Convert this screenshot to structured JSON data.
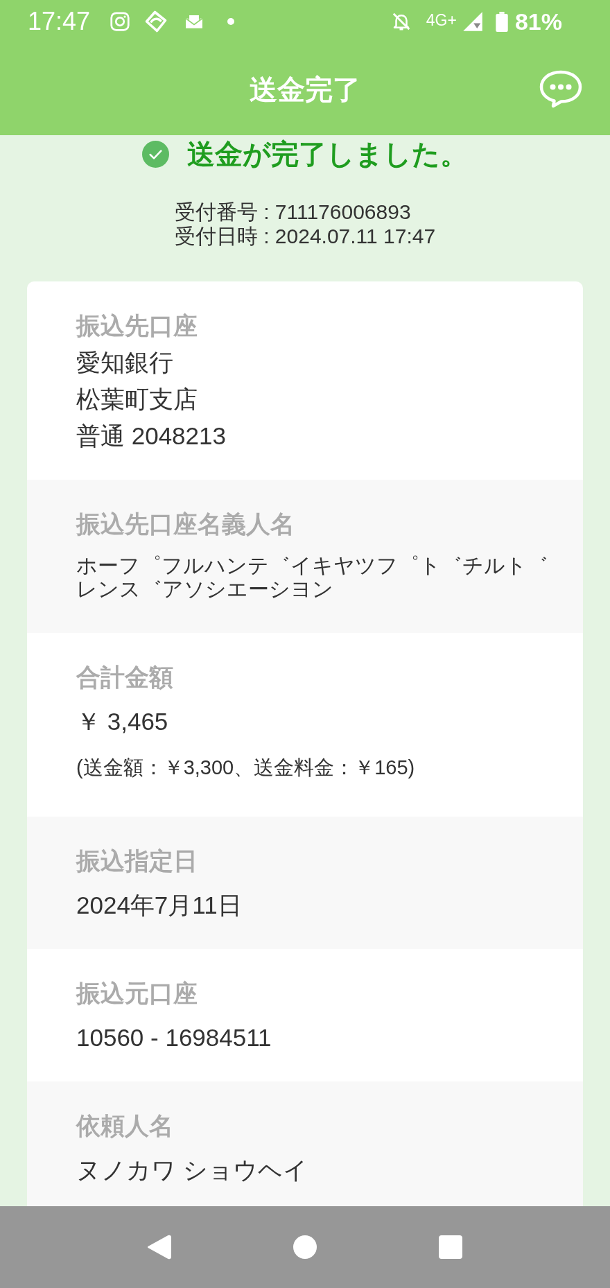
{
  "status_bar": {
    "time": "17:47",
    "network": "4G+",
    "battery": "81%"
  },
  "header": {
    "title": "送金完了"
  },
  "result": {
    "message": "送金が完了しました。"
  },
  "receipt": [
    "受付番号 : 711176006893",
    "受付日時 : 2024.07.11 17:47"
  ],
  "details": [
    {
      "label": "振込先口座",
      "lines": [
        {
          "kind": "line",
          "text": "愛知銀行"
        },
        {
          "kind": "line",
          "text": "松葉町支店"
        },
        {
          "kind": "line",
          "text": "普通 2048213"
        }
      ]
    },
    {
      "label": "振込先口座名義人名",
      "lines": [
        {
          "kind": "name",
          "text": "ホーフ゜フルハンテ゛イキヤツフ゜ト゛チルト゛レンス゛アソシエーシヨン"
        }
      ]
    },
    {
      "label": "合計金額",
      "lines": [
        {
          "kind": "value",
          "text": "￥ 3,465"
        },
        {
          "kind": "note",
          "text": "(送金額：￥3,300、送金料金：￥165)"
        }
      ]
    },
    {
      "label": "振込指定日",
      "lines": [
        {
          "kind": "value",
          "text": "2024年7月11日"
        }
      ]
    },
    {
      "label": "振込元口座",
      "lines": [
        {
          "kind": "value",
          "text": "10560 - 16984511"
        }
      ]
    },
    {
      "label": "依頼人名",
      "lines": [
        {
          "kind": "value",
          "text": "ヌノカワ ショウヘイ"
        }
      ]
    }
  ]
}
